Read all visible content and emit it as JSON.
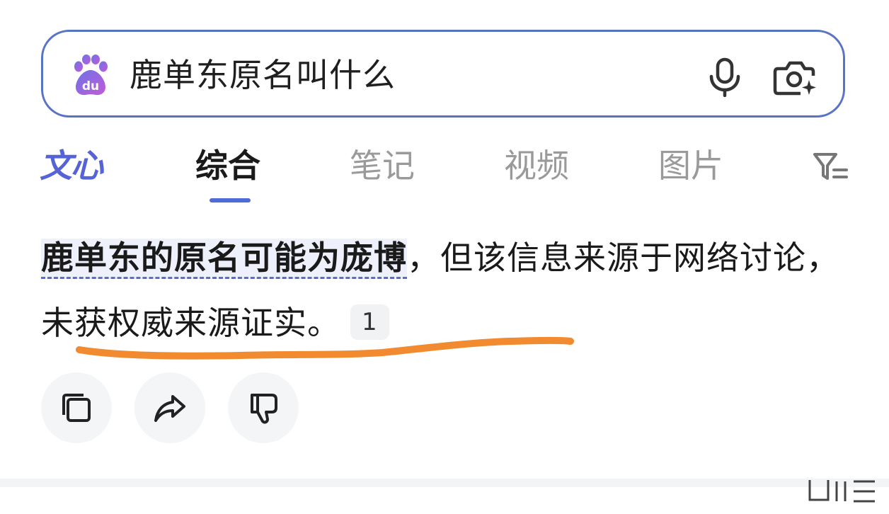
{
  "search": {
    "query": "鹿单东原名叫什么",
    "logo": "baidu-paw-icon",
    "mic_icon": "microphone-icon",
    "camera_icon": "camera-ai-icon"
  },
  "tabs": [
    {
      "label": "文心",
      "active": false
    },
    {
      "label": "综合",
      "active": true
    },
    {
      "label": "笔记",
      "active": false
    },
    {
      "label": "视频",
      "active": false
    },
    {
      "label": "图片",
      "active": false
    }
  ],
  "filter_icon": "filter-icon",
  "answer": {
    "highlight_1": "鹿单东的原名可能为庞博",
    "text_1": "，但该信息来源于网络讨论，未获权威来源证实。",
    "citation": "1"
  },
  "actions": {
    "copy_icon": "copy-icon",
    "share_icon": "share-icon",
    "dislike_icon": "thumbs-down-icon"
  },
  "colors": {
    "brand_blue": "#4f6bd8",
    "search_border": "#5a74c4",
    "annotation_orange": "#f28a30"
  }
}
